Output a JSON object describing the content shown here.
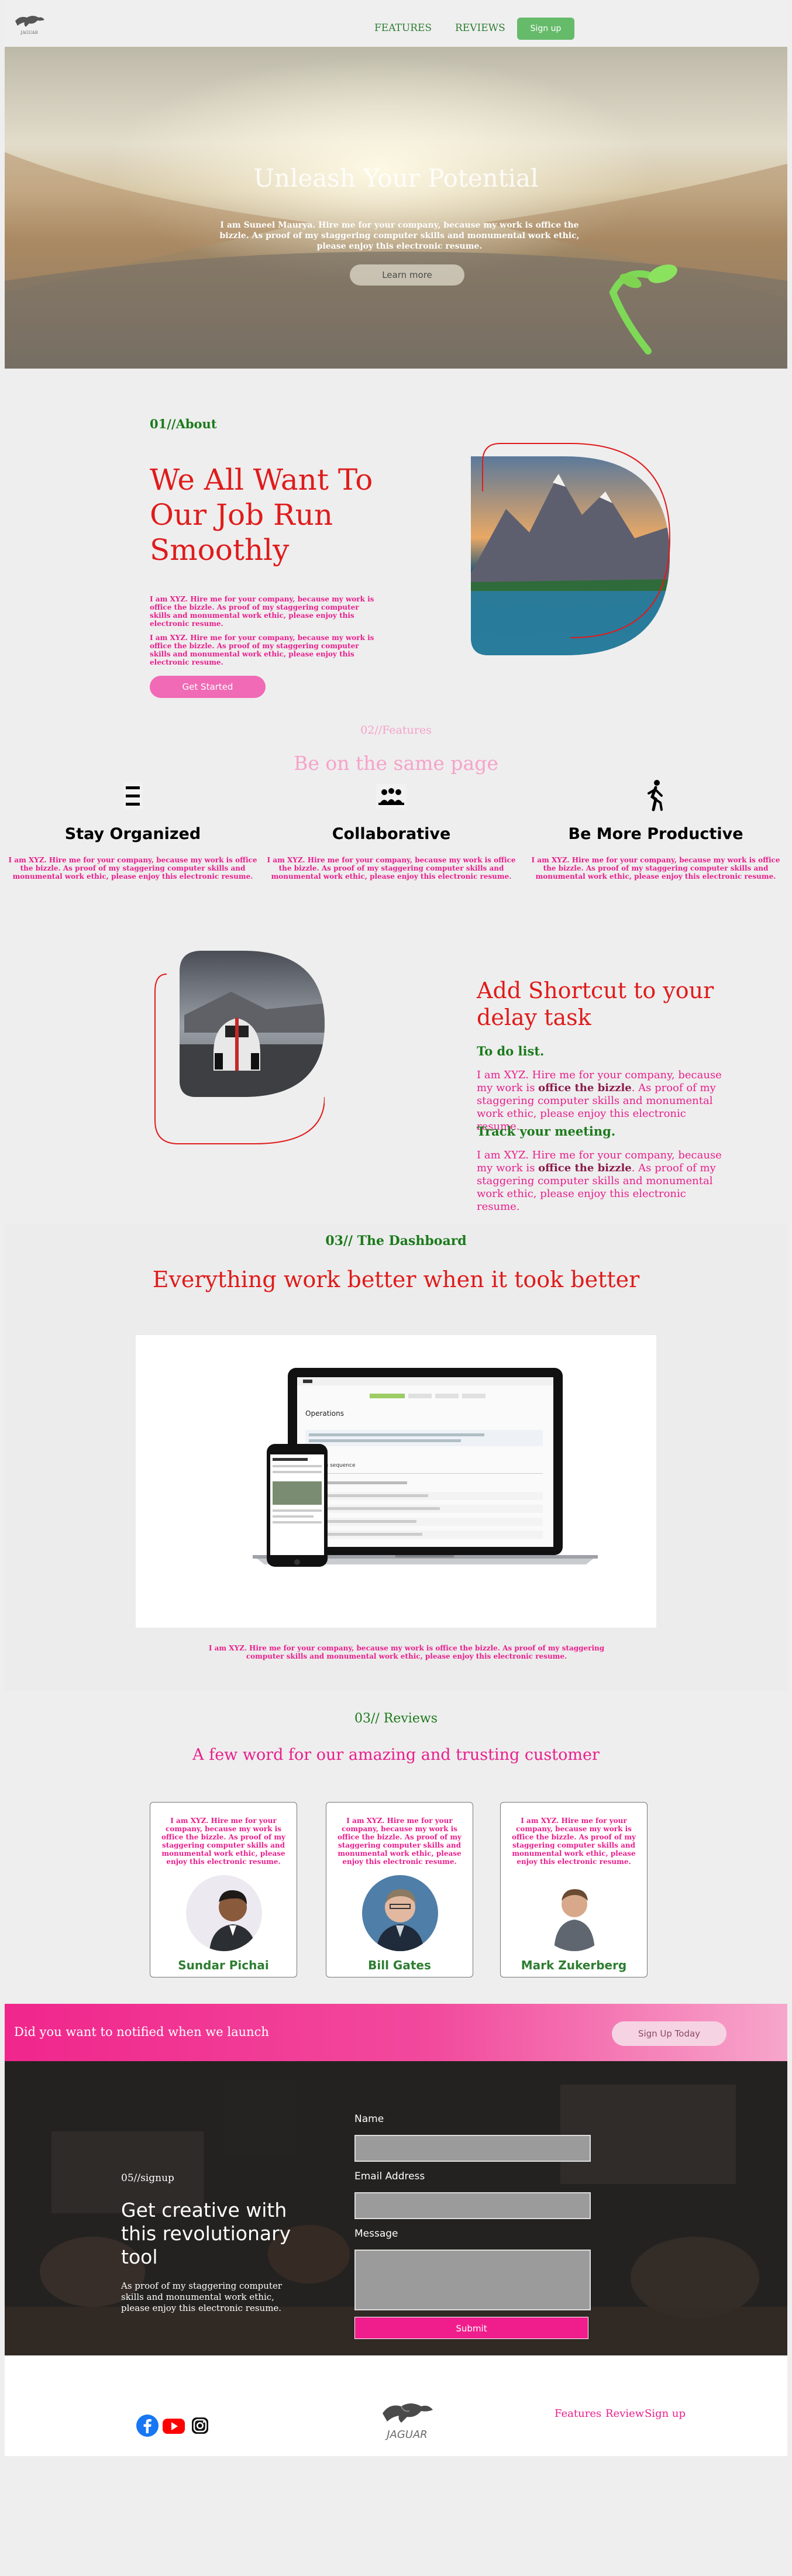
{
  "nav": {
    "logo_text": "JAGUAR",
    "links": [
      "FEATURES",
      "REVIEWS"
    ],
    "signup_label": "Sign up"
  },
  "hero": {
    "title": "Unleash Your Potential",
    "subtitle": "I am Suneel Maurya. Hire me for your company, because my work is office the bizzle. As proof of my staggering computer skills and monumental work ethic, please enjoy this electronic resume.",
    "button": "Learn more"
  },
  "about": {
    "eyebrow": "01//About",
    "title": "We All Want To Our Job Run Smoothly",
    "p1": "I am XYZ. Hire me for your company, because my work is office the bizzle. As proof of my staggering computer skills and monumental work ethic, please enjoy this electronic resume.",
    "p2": "I am XYZ. Hire me for your company, because my work is office the bizzle. As proof of my staggering computer skills and monumental work ethic, please enjoy this electronic resume.",
    "button": "Get Started"
  },
  "features": {
    "eyebrow": "02//Features",
    "title": "Be on the same page",
    "items": [
      {
        "title": "Stay Organized",
        "icon": "menu-icon",
        "desc": "I am XYZ. Hire me for your company, because my work is office the bizzle. As proof of my staggering computer skills and monumental work ethic, please enjoy this electronic resume."
      },
      {
        "title": "Collaborative",
        "icon": "team-icon",
        "desc": "I am XYZ. Hire me for your company, because my work is office the bizzle. As proof of my staggering computer skills and monumental work ethic, please enjoy this electronic resume."
      },
      {
        "title": "Be More Productive",
        "icon": "walking-person-icon",
        "desc": "I am XYZ. Hire me for your company, because my work is office the bizzle. As proof of my staggering computer skills and monumental work ethic, please enjoy this electronic resume."
      }
    ]
  },
  "shortcut": {
    "title": "Add Shortcut to your delay task",
    "h1": "To do list.",
    "p1_a": "I am XYZ. Hire me for your company, because my work is ",
    "p1_bold": "office the bizzle",
    "p1_b": ". As proof of my staggering computer skills and monumental work ethic, please enjoy this electronic resume.",
    "h2": "Track your meeting.",
    "p2_a": "I am XYZ. Hire me for your company, because my work is ",
    "p2_bold": "office the bizzle",
    "p2_b": ". As proof of my staggering computer skills and monumental work ethic, please enjoy this electronic resume."
  },
  "dashboard": {
    "eyebrow": "03// The Dashboard",
    "title": "Everything work better when it took better",
    "screen_heading": "Operations",
    "screen_section": "Shipping sequence",
    "desc": "I am XYZ. Hire me for your company, because my work is office the bizzle. As proof of my staggering computer skills and monumental work ethic, please enjoy this electronic resume."
  },
  "reviews": {
    "eyebrow": "03// Reviews",
    "title": "A few word for our amazing and trusting customer",
    "cards": [
      {
        "quote": "I am XYZ. Hire me for your company, because my work is office the bizzle. As proof of my staggering computer skills and monumental work ethic, please enjoy this electronic resume.",
        "name": "Sundar Pichai"
      },
      {
        "quote": "I am XYZ. Hire me for your company, because my work is office the bizzle. As proof of my staggering computer skills and monumental work ethic, please enjoy this electronic resume.",
        "name": "Bill Gates"
      },
      {
        "quote": "I am XYZ. Hire me for your company, because my work is office the bizzle. As proof of my staggering computer skills and monumental work ethic, please enjoy this electronic resume.",
        "name": "Mark Zukerberg"
      }
    ]
  },
  "notify": {
    "text": "Did you want to notified when we launch",
    "button": "Sign Up Today"
  },
  "signup": {
    "eyebrow": "05//signup",
    "title": "Get creative with this revolutionary tool",
    "desc": "As proof of my staggering computer skills and monumental work ethic, please enjoy this electronic resume.",
    "name_label": "Name",
    "email_label": "Email Address",
    "message_label": "Message",
    "submit": "Submit"
  },
  "footer": {
    "social": [
      "facebook-icon",
      "youtube-icon",
      "instagram-icon"
    ],
    "logo_text": "JAGUAR",
    "links": [
      "Features",
      "Review",
      "Sign up"
    ]
  },
  "colors": {
    "green": "#1b7a1b",
    "red": "#e01b1b",
    "pink": "#e91e8c",
    "button_green": "#66bb6a"
  }
}
